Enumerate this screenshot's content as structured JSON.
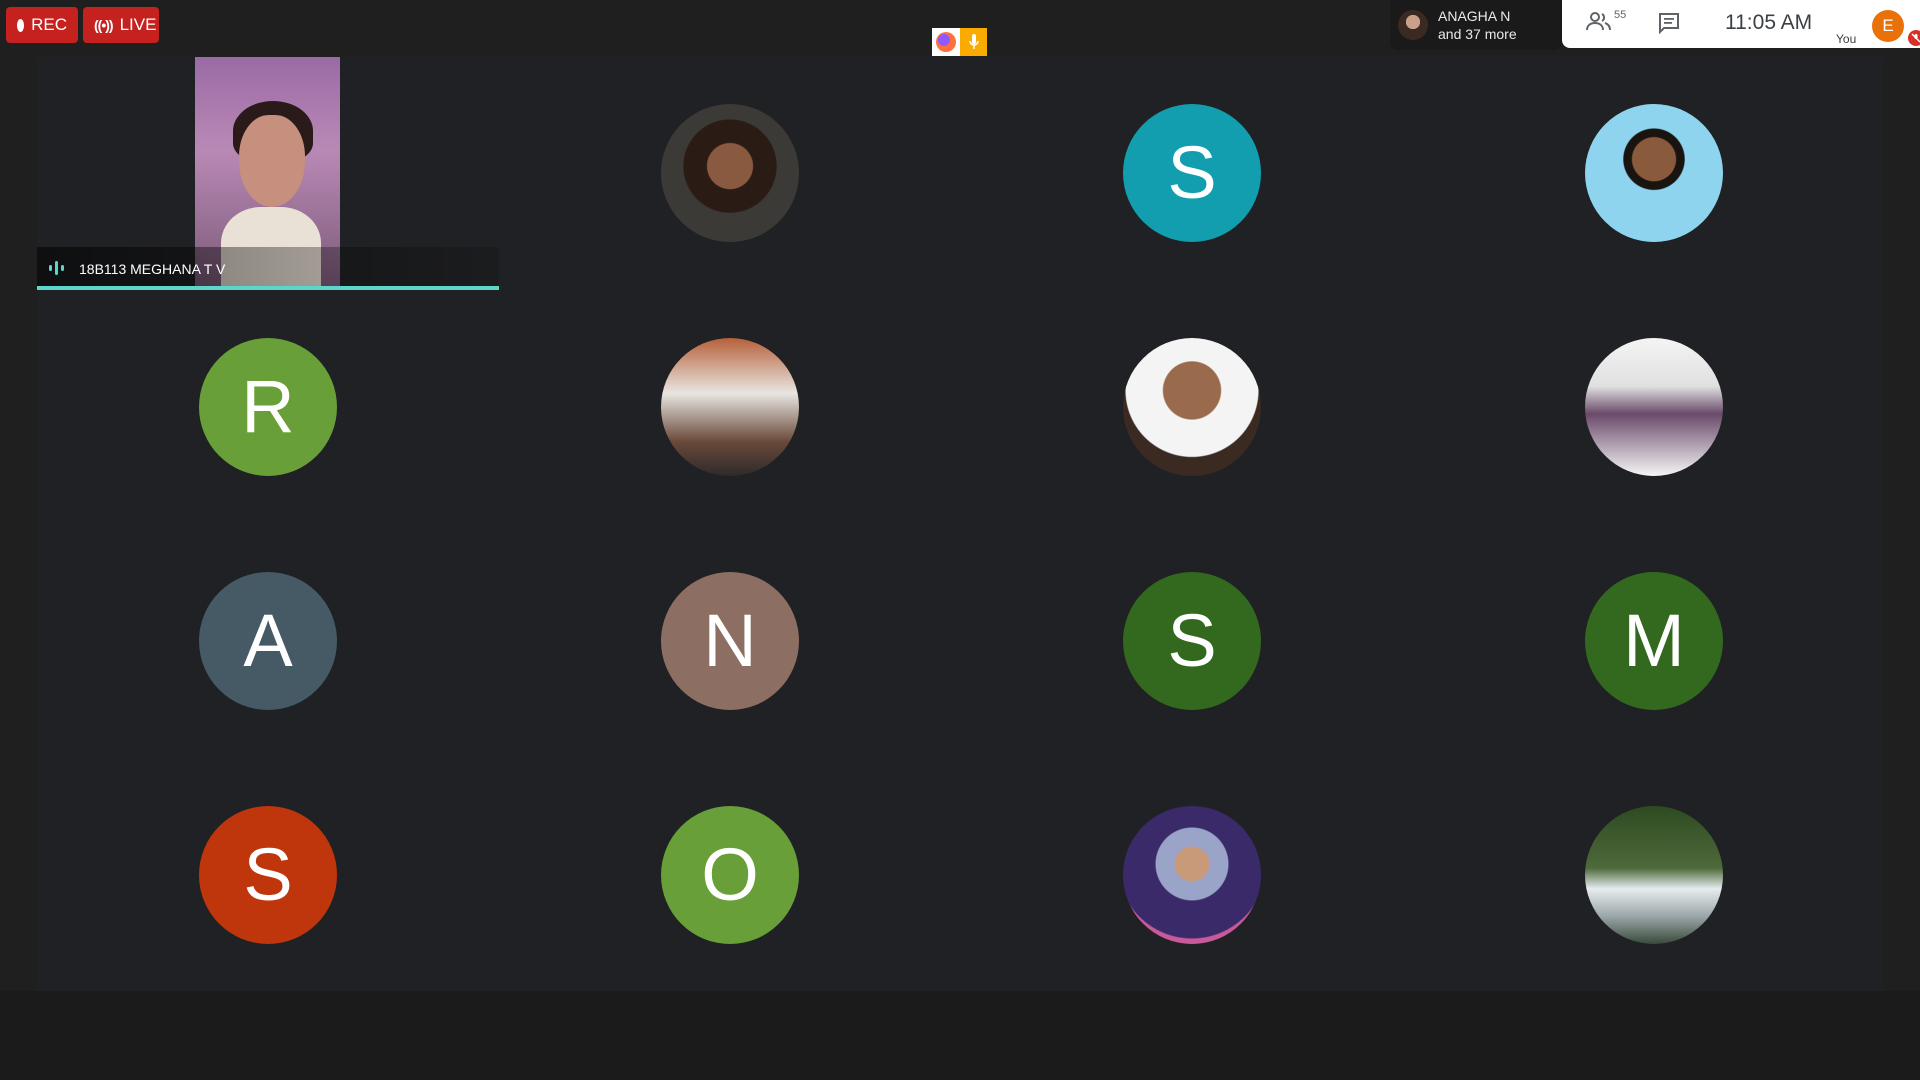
{
  "recording": {
    "rec_label": "REC",
    "live_label": "LIVE"
  },
  "active_speaker": {
    "name": "ANAGHA N",
    "others": "and 37 more"
  },
  "controls": {
    "people_count": "55",
    "time": "11:05 AM",
    "you_initial": "E",
    "you_label": "You"
  },
  "colors": {
    "teal": "#129eaf",
    "lime": "#689f38",
    "slate": "#455a64",
    "mauve": "#8d6e63",
    "forest": "#33691e",
    "rust": "#bf360c",
    "accent_line": "#5bd6c9",
    "rec_red": "#c5221f"
  },
  "tiles": [
    {
      "kind": "video",
      "label": "18B113 MEGHANA T V"
    },
    {
      "kind": "photo",
      "icon": "woman-portrait-photo"
    },
    {
      "kind": "initial",
      "letter": "S",
      "color": "#129eaf"
    },
    {
      "kind": "photo",
      "icon": "man-portrait-photo"
    },
    {
      "kind": "initial",
      "letter": "R",
      "color": "#689f38"
    },
    {
      "kind": "photo",
      "icon": "classroom-photo"
    },
    {
      "kind": "photo",
      "icon": "man-glasses-photo"
    },
    {
      "kind": "photo",
      "icon": "award-group-photo"
    },
    {
      "kind": "initial",
      "letter": "A",
      "color": "#455a64"
    },
    {
      "kind": "initial",
      "letter": "N",
      "color": "#8d6e63"
    },
    {
      "kind": "initial",
      "letter": "S",
      "color": "#33691e"
    },
    {
      "kind": "initial",
      "letter": "M",
      "color": "#33691e"
    },
    {
      "kind": "initial",
      "letter": "S",
      "color": "#bf360c"
    },
    {
      "kind": "initial",
      "letter": "O",
      "color": "#689f38"
    },
    {
      "kind": "photo",
      "icon": "woman-hijab-photo"
    },
    {
      "kind": "photo",
      "icon": "waterfall-photo"
    }
  ]
}
